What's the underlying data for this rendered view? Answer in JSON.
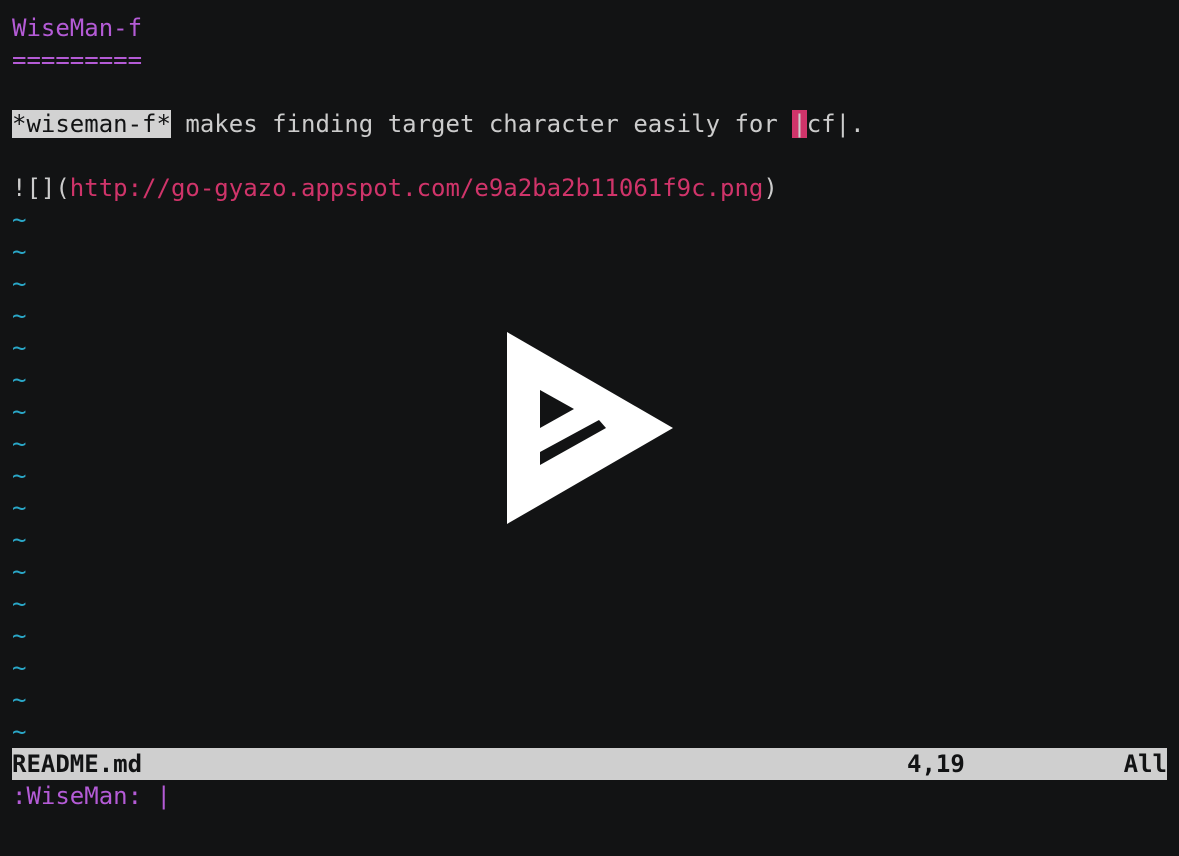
{
  "editor": {
    "lines": {
      "heading": "WiseMan-f",
      "underline": "=========",
      "desc_highlight": "*wiseman-f*",
      "desc_mid": " makes finding target character easily for ",
      "desc_cursor": "|",
      "desc_tail": "cf|.",
      "img_prefix": "![](",
      "img_url": "http://go-gyazo.appspot.com/e9a2ba2b11061f9c.png",
      "img_suffix": ")"
    },
    "tilde": "~"
  },
  "statusline": {
    "filename": "README.md",
    "position": "4,19",
    "percent": "All"
  },
  "cmdline": {
    "text": ":WiseMan: |"
  },
  "overlay": {
    "icon": "asciinema-play-icon",
    "color": "#ffffff"
  },
  "colors": {
    "background": "#121314",
    "heading": "#b45bd6",
    "url": "#d0346a",
    "tilde": "#2aa7c7",
    "statusline_bg": "#cfcfcf"
  }
}
